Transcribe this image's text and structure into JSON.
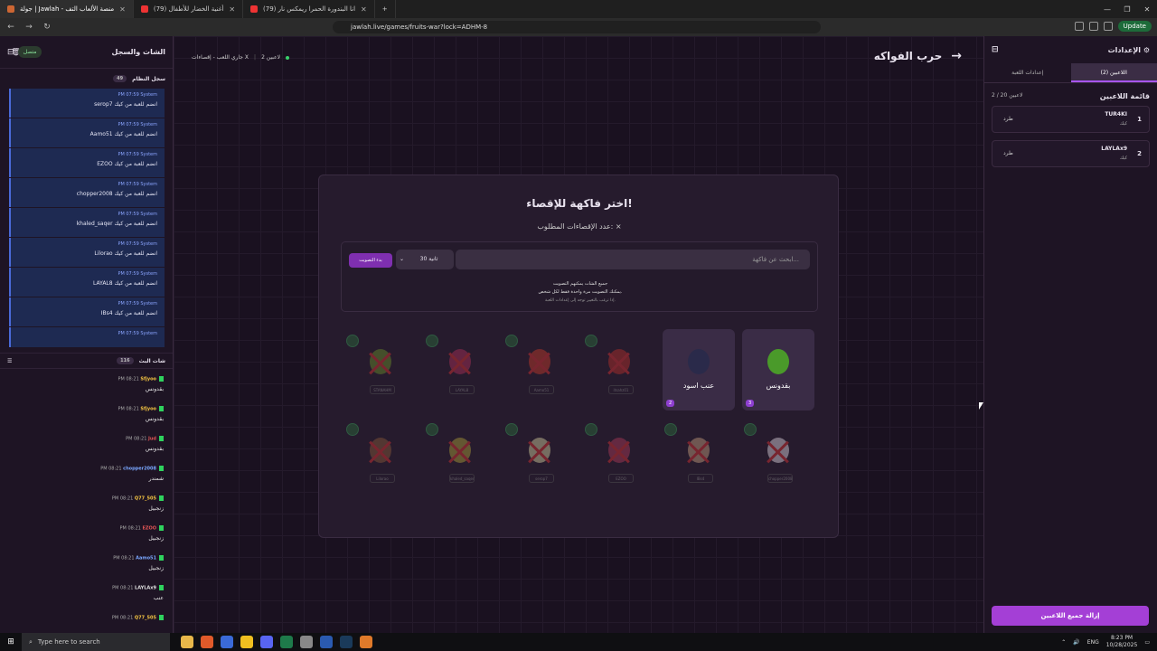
{
  "browser": {
    "tabs": [
      {
        "title": "جولة | Jawlah - منصة الألعاب التف"
      },
      {
        "title": "(79) أغنية الخضار للأطفال"
      },
      {
        "title": "(79) انا البندورة الحمرا ريمكس نار"
      }
    ],
    "new_tab": "+",
    "url": "jawlah.live/games/fruits-war?lock=ADHM-8",
    "update_label": "Update"
  },
  "left_panel": {
    "title": "الشات والسجل",
    "connected": "متصل",
    "system_log_title": "سجل النظام",
    "system_log_count": "49",
    "system_log": [
      {
        "meta": "PM 07:59  System",
        "msg": "serop7 انضم للعبة من كيك"
      },
      {
        "meta": "PM 07:59  System",
        "msg": "Aamo51 انضم للعبة من كيك"
      },
      {
        "meta": "PM 07:59  System",
        "msg": "EZOO انضم للعبة من كيك"
      },
      {
        "meta": "PM 07:59  System",
        "msg": "chopper2008 انضم للعبة من كيك"
      },
      {
        "meta": "PM 07:59  System",
        "msg": "khaled_saqer انضم للعبة من كيك"
      },
      {
        "meta": "PM 07:59  System",
        "msg": "Lilorao انضم للعبة من كيك"
      },
      {
        "meta": "PM 07:59  System",
        "msg": "LAYAL8 انضم للعبة من كيك"
      },
      {
        "meta": "PM 07:59  System",
        "msg": "IBs4 انضم للعبة من كيك"
      },
      {
        "meta": "PM 07:59  System",
        "msg": ""
      }
    ],
    "live_chat_title": "شات البث",
    "live_chat_count": "116",
    "chat": [
      {
        "time": "PM 08:21",
        "user": "Sfjyoo",
        "text": "بقدونس",
        "color": "#f5c542"
      },
      {
        "time": "PM 08:21",
        "user": "Sfjyoo",
        "text": "بقدونس",
        "color": "#f5c542"
      },
      {
        "time": "PM 08:21",
        "user": "Jud",
        "text": "بقدونس",
        "color": "#e05555"
      },
      {
        "time": "PM 08:21",
        "user": "chopper2008",
        "text": "شمندر",
        "color": "#7aa7ff"
      },
      {
        "time": "PM 08:21",
        "user": "Q77_505",
        "text": "زنجبيل",
        "color": "#f5c542"
      },
      {
        "time": "PM 08:21",
        "user": "EZOO",
        "text": "زنجبيل",
        "color": "#e05555"
      },
      {
        "time": "PM 08:21",
        "user": "Aamo51",
        "text": "زنجبيل",
        "color": "#7aa7ff"
      },
      {
        "time": "PM 08:21",
        "user": "LAYLAx9",
        "text": "عنب",
        "color": "#e0e0e0"
      },
      {
        "time": "PM 08:21",
        "user": "Q77_505",
        "text": "",
        "color": "#f5c542"
      }
    ]
  },
  "main": {
    "status_players": "2 لاعبين",
    "status_state": "جاري اللعب - إقصاءات X",
    "game_title": "حرب الفواكه",
    "card_title": "اختر فاكهة للإقصاء!",
    "card_sub": "عدد الإقصاءات المطلوب: ×",
    "search_placeholder": "ابحث عن فاكهة...",
    "timer_label": "30 ثانية",
    "start_vote": "بدء التصويت",
    "note1": "جميع الشات يمكنهم التصويت",
    "note2": "يمكنك التصويت مرة واحدة فقط لكل شخص.",
    "note3": "إذا ترغب بالتغيير توجه إلى إعدادات اللعبة.",
    "fruits_row1": [
      {
        "tag": "STANAHM",
        "color": "#6b8f2a",
        "state": "out"
      },
      {
        "tag": "LAYAL8",
        "color": "#b0305a",
        "state": "out"
      },
      {
        "tag": "Aamo51",
        "color": "#c83a2a",
        "state": "out"
      },
      {
        "tag": "itsahz01",
        "color": "#b8302a",
        "state": "out"
      },
      {
        "name": "عنب اسود",
        "votes": "2",
        "color": "#2a2a4a",
        "state": "active"
      },
      {
        "name": "بقدونس",
        "votes": "3",
        "color": "#4a9a2a",
        "state": "active"
      }
    ],
    "fruits_row2": [
      {
        "tag": "Lilorao",
        "color": "#8a5a3a",
        "state": "out"
      },
      {
        "tag": "khaled_saqer",
        "color": "#b0a03a",
        "state": "out"
      },
      {
        "tag": "serop7",
        "color": "#d8d0a0",
        "state": "out"
      },
      {
        "tag": "EZOO",
        "color": "#b03a5a",
        "state": "out"
      },
      {
        "tag": "IBs4",
        "color": "#c8a080",
        "state": "out"
      },
      {
        "tag": "chopper2008",
        "color": "#e0d8e0",
        "state": "out"
      }
    ]
  },
  "right_panel": {
    "title": "الإعدادات",
    "tab_players": "اللاعبين (2)",
    "tab_settings": "إعدادات اللعبة",
    "players_title": "قائمة اللاعبين",
    "players_count": "2 / 20 لاعبين",
    "players": [
      {
        "rank": "1",
        "name": "TUR4KI",
        "platform": "كيك",
        "kick": "طرد"
      },
      {
        "rank": "2",
        "name": "LAYLAx9",
        "platform": "كيك",
        "kick": "طرد"
      }
    ],
    "remove_all": "إزالة جميع اللاعبين"
  },
  "taskbar": {
    "search_placeholder": "Type here to search",
    "lang": "ENG",
    "time": "8:23 PM",
    "date": "10/28/2025"
  }
}
